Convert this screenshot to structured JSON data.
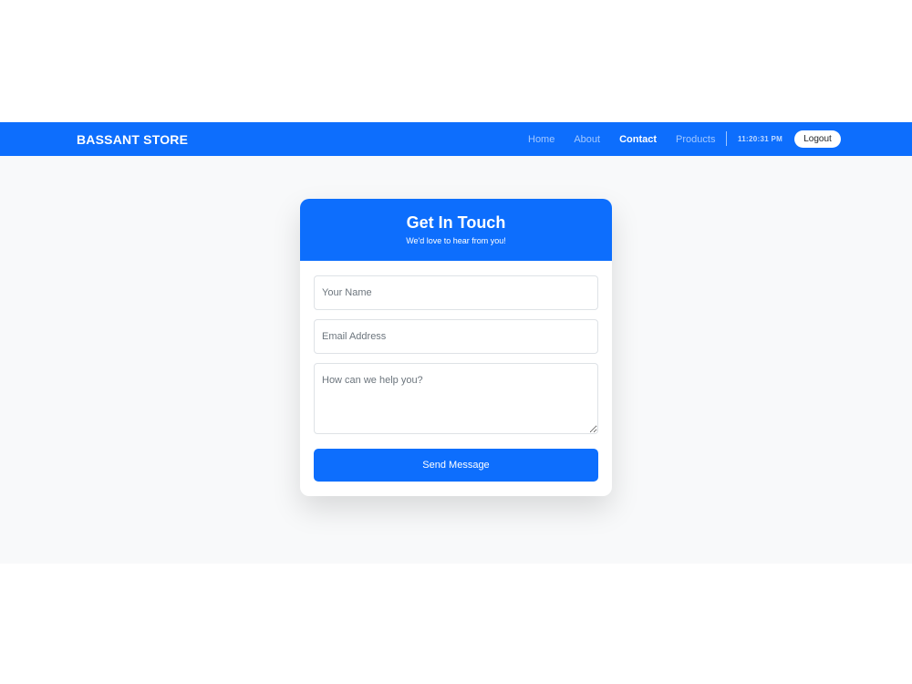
{
  "navbar": {
    "brand": "BASSANT STORE",
    "links": [
      {
        "label": "Home",
        "active": false
      },
      {
        "label": "About",
        "active": false
      },
      {
        "label": "Contact",
        "active": true
      },
      {
        "label": "Products",
        "active": false
      }
    ],
    "clock": "11:20:31 PM",
    "logout_label": "Logout"
  },
  "contact_card": {
    "title": "Get In Touch",
    "subtitle": "We'd love to hear from you!",
    "name_placeholder": "Your Name",
    "email_placeholder": "Email Address",
    "message_placeholder": "How can we help you?",
    "submit_label": "Send Message"
  },
  "colors": {
    "primary": "#0d6efd",
    "page_background": "#f8f9fa"
  }
}
